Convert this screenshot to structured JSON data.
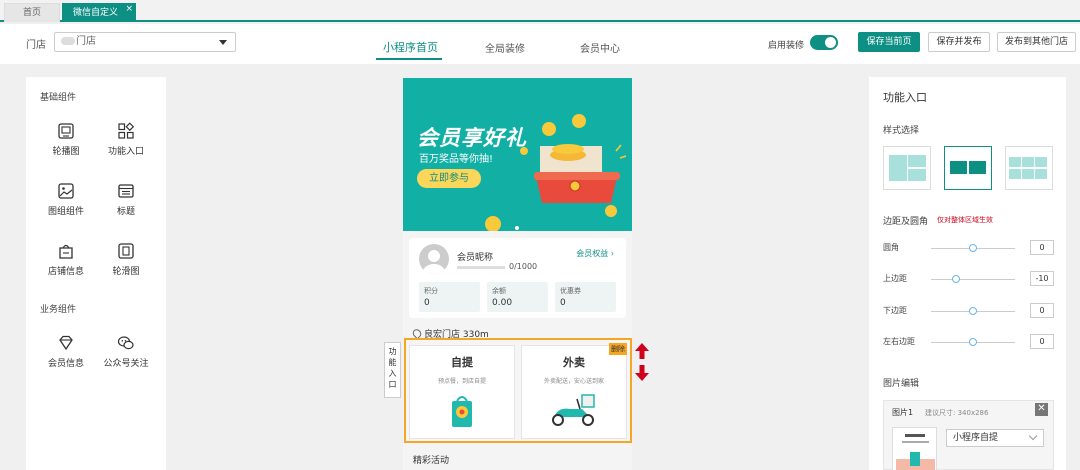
{
  "tabs": {
    "home": "首页",
    "active": "微信自定义页面",
    "close": "×"
  },
  "header": {
    "store_label": "门店",
    "store_value": "门店",
    "nav": [
      "小程序首页",
      "全局装修",
      "会员中心"
    ],
    "enable_label": "启用装修",
    "buttons": {
      "save_current": "保存当前页",
      "save_publish": "保存并发布",
      "publish_other": "发布到其他门店"
    },
    "accent": "#0e8f84"
  },
  "left_panel": {
    "basic_title": "基础组件",
    "basic": [
      {
        "label": "轮播图",
        "icon": "carousel-icon"
      },
      {
        "label": "功能入口",
        "icon": "grid-icon"
      },
      {
        "label": "图组组件",
        "icon": "image-icon"
      },
      {
        "label": "标题",
        "icon": "title-icon"
      },
      {
        "label": "店铺信息",
        "icon": "store-icon"
      },
      {
        "label": "轮滑图",
        "icon": "slider-icon"
      }
    ],
    "business_title": "业务组件",
    "business": [
      {
        "label": "会员信息",
        "icon": "diamond-icon"
      },
      {
        "label": "公众号关注",
        "icon": "wechat-icon"
      }
    ]
  },
  "phone": {
    "banner": {
      "title": "会员享好礼",
      "subtitle": "百万奖品等你抽!",
      "button": "立即参与",
      "bg": "#12b0a4"
    },
    "member": {
      "nickname": "会员昵称",
      "progress": "0/1000",
      "progress_fraction": 0,
      "rights": "会员权益",
      "stats": [
        {
          "label": "积分",
          "value": "0"
        },
        {
          "label": "余额",
          "value": "0.00"
        },
        {
          "label": "优惠券",
          "value": "0"
        }
      ]
    },
    "location": "良宏门店 330m",
    "features": [
      {
        "title": "自提",
        "subtitle": "预点餐，到店自提"
      },
      {
        "title": "外卖",
        "subtitle": "外卖配送，安心送到家"
      }
    ],
    "delete_tag": "删除",
    "side_label": [
      "功",
      "能",
      "入",
      "口"
    ],
    "activity": "精彩活动"
  },
  "right_panel": {
    "title": "功能入口",
    "style_label": "样式选择",
    "margin_label": "边距及圆角",
    "margin_note": "仅对整体区域生效",
    "sliders": [
      {
        "label": "圆角",
        "value": "0",
        "level": 0.5
      },
      {
        "label": "上边距",
        "value": "-10",
        "level": 0.3
      },
      {
        "label": "下边距",
        "value": "0",
        "level": 0.5
      },
      {
        "label": "左右边距",
        "value": "0",
        "level": 0.5
      }
    ],
    "image_edit_label": "图片编辑",
    "image": {
      "name": "图片1",
      "size_hint": "建议尺寸: 340x286",
      "select_value": "小程序自提",
      "close": "✕"
    }
  }
}
